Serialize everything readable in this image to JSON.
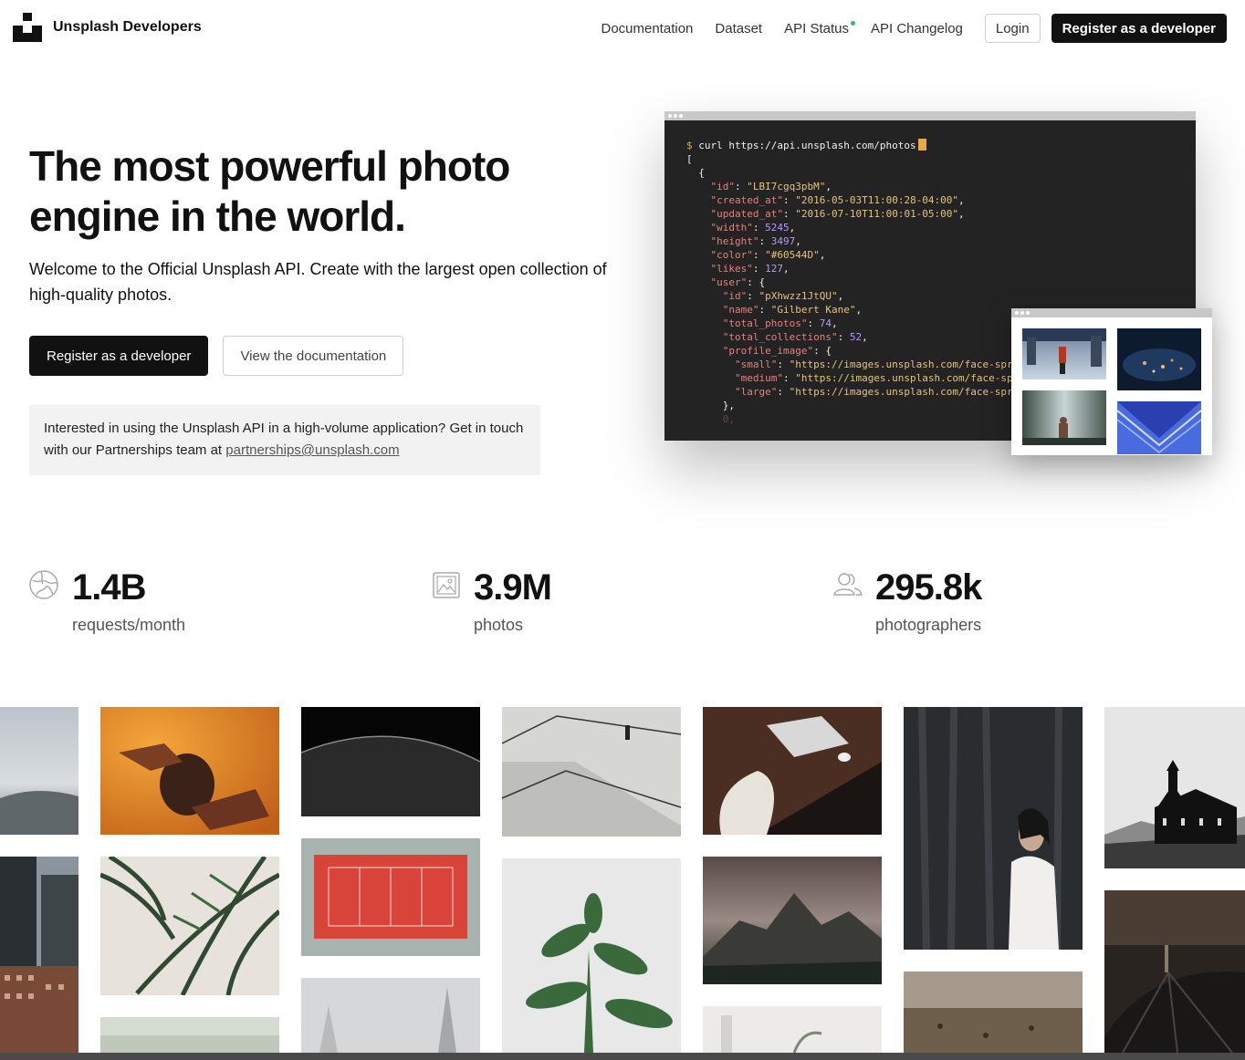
{
  "header": {
    "brand": "Unsplash Developers",
    "nav": [
      "Documentation",
      "Dataset",
      "API Status",
      "API Changelog"
    ],
    "login": "Login",
    "register": "Register as a developer",
    "status_color": "#3cb46e"
  },
  "hero": {
    "title": "The most powerful photo engine in the world.",
    "subtitle": "Welcome to the Official Unsplash API. Create with the largest open collection of high-quality photos.",
    "primary_button": "Register as a developer",
    "secondary_button": "View the documentation",
    "partner_text": "Interested in using the Unsplash API in a high-volume application? Get in touch with our Partnerships team at",
    "partner_email": "partnerships@unsplash.com"
  },
  "terminal": {
    "command": "curl https://api.unsplash.com/photos",
    "prompt": "$",
    "lines": [
      {
        "t": "p",
        "v": "["
      },
      {
        "t": "p",
        "v": "  {"
      },
      {
        "t": "kv",
        "k": "\"id\"",
        "v": "\"LBI7cgq3pbM\"",
        "vt": "s",
        "ind": 4
      },
      {
        "t": "kv",
        "k": "\"created_at\"",
        "v": "\"2016-05-03T11:00:28-04:00\"",
        "vt": "s",
        "ind": 4
      },
      {
        "t": "kv",
        "k": "\"updated_at\"",
        "v": "\"2016-07-10T11:00:01-05:00\"",
        "vt": "s",
        "ind": 4
      },
      {
        "t": "kv",
        "k": "\"width\"",
        "v": "5245",
        "vt": "n",
        "ind": 4
      },
      {
        "t": "kv",
        "k": "\"height\"",
        "v": "3497",
        "vt": "n",
        "ind": 4
      },
      {
        "t": "kv",
        "k": "\"color\"",
        "v": "\"#60544D\"",
        "vt": "s",
        "ind": 4
      },
      {
        "t": "kv",
        "k": "\"likes\"",
        "v": "127",
        "vt": "n",
        "ind": 4
      },
      {
        "t": "ko",
        "k": "\"user\"",
        "v": "{",
        "ind": 4
      },
      {
        "t": "kv",
        "k": "\"id\"",
        "v": "\"pXhwzz1JtQU\"",
        "vt": "s",
        "ind": 6
      },
      {
        "t": "kv",
        "k": "\"name\"",
        "v": "\"Gilbert Kane\"",
        "vt": "s",
        "ind": 6
      },
      {
        "t": "kv",
        "k": "\"total_photos\"",
        "v": "74",
        "vt": "n",
        "ind": 6
      },
      {
        "t": "kv",
        "k": "\"total_collections\"",
        "v": "52",
        "vt": "n",
        "ind": 6
      },
      {
        "t": "ko",
        "k": "\"profile_image\"",
        "v": "{",
        "ind": 6
      },
      {
        "t": "kv",
        "k": "\"small\"",
        "v": "\"https://images.unsplash.com/face-springmorning.jpg\"",
        "vt": "s",
        "ind": 8
      },
      {
        "t": "kv",
        "k": "\"medium\"",
        "v": "\"https://images.unsplash.com/face-springmorning.jpg\"",
        "vt": "s",
        "ind": 8
      },
      {
        "t": "kv",
        "k": "\"large\"",
        "v": "\"https://images.unsplash.com/face-springmorning.jpg\"",
        "vt": "s",
        "ind": 8
      },
      {
        "t": "p",
        "v": "      },",
        "fade": false
      },
      {
        "t": "k",
        "v": "      0,",
        "fade": true
      }
    ]
  },
  "stats": [
    {
      "value": "1.4B",
      "label": "requests/month",
      "icon": "globe-icon"
    },
    {
      "value": "3.9M",
      "label": "photos",
      "icon": "image-icon"
    },
    {
      "value": "295.8k",
      "label": "photographers",
      "icon": "people-icon"
    }
  ]
}
